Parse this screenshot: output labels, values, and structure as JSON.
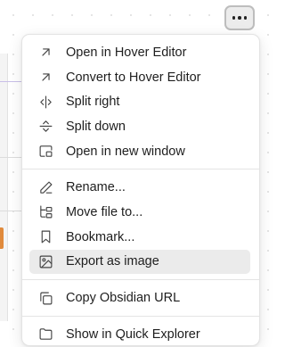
{
  "more_button": {
    "icon": "more-horizontal-icon"
  },
  "menu": {
    "groups": [
      [
        {
          "label": "Open in Hover Editor",
          "icon": "arrow-up-right-icon"
        },
        {
          "label": "Convert to Hover Editor",
          "icon": "arrow-up-right-icon"
        },
        {
          "label": "Split right",
          "icon": "split-vertical-icon"
        },
        {
          "label": "Split down",
          "icon": "split-horizontal-icon"
        },
        {
          "label": "Open in new window",
          "icon": "new-window-icon"
        }
      ],
      [
        {
          "label": "Rename...",
          "icon": "pencil-icon"
        },
        {
          "label": "Move file to...",
          "icon": "folder-tree-icon"
        },
        {
          "label": "Bookmark...",
          "icon": "bookmark-icon"
        },
        {
          "label": "Export as image",
          "icon": "image-icon",
          "active": true
        }
      ],
      [
        {
          "label": "Copy Obsidian URL",
          "icon": "copy-icon"
        }
      ],
      [
        {
          "label": "Show in Quick Explorer",
          "icon": "folder-icon"
        }
      ]
    ]
  }
}
